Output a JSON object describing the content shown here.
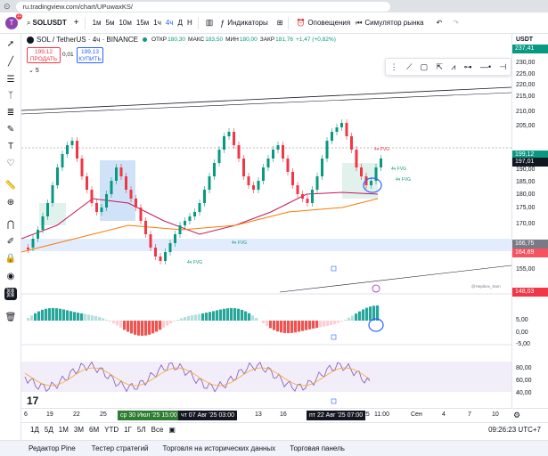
{
  "browser": {
    "url": "ru.tradingview.com/chart/UPuwaxKS/"
  },
  "avatar": {
    "letter": "T",
    "badge": "11"
  },
  "toolbar": {
    "symbol": "SOLUSDT",
    "intervals": [
      "1м",
      "5м",
      "10м",
      "15м",
      "1ч",
      "4ч",
      "Д",
      "Н"
    ],
    "indicators_label": "Индикаторы",
    "alerts_label": "Оповещения",
    "replay_label": "Симулятор рынка"
  },
  "header": {
    "title": "SOL / TetherUS · 4ч · BINANCE",
    "open_label": "ОТКР",
    "open": "180,30",
    "high_label": "МАКС",
    "high": "183,50",
    "low_label": "МИН",
    "low": "180,00",
    "close_label": "ЗАКР",
    "close": "181,76",
    "change": "+1,47 (+0,82%)"
  },
  "trade": {
    "sell_price": "199,12",
    "sell_label": "ПРОДАТЬ",
    "spread": "0,01",
    "buy_price": "199,13",
    "buy_label": "КУПИТЬ"
  },
  "indicator_row": "5",
  "price_axis": {
    "currency": "USDT",
    "ticks": [
      "235,00",
      "230,00",
      "225,00",
      "220,00",
      "215,00",
      "210,00",
      "205,00",
      "195,00",
      "190,00",
      "185,00",
      "180,00",
      "175,00",
      "170,00",
      "160,00",
      "155,00"
    ],
    "labels": [
      {
        "text": "237,41",
        "color": "#089981"
      },
      {
        "text": "199,12",
        "color": "#089981"
      },
      {
        "text": "197,01",
        "color": "#131722"
      },
      {
        "text": "166,75",
        "color": "#787b86"
      },
      {
        "text": "164,69",
        "color": "#f7525f"
      },
      {
        "text": "148,03",
        "color": "#f23645"
      }
    ],
    "osc_ticks": [
      "5,00",
      "0,00",
      "-5,00"
    ],
    "rsi_ticks": [
      "80,00",
      "60,00",
      "40,00"
    ]
  },
  "fvg_label": "4ч FVG",
  "watermark": "@Hepikov_Sam",
  "time_axis": {
    "ticks": [
      "6",
      "19",
      "22",
      "25",
      "13",
      "16",
      "25",
      "11:00",
      "Сен",
      "4",
      "7",
      "10"
    ],
    "highlights": [
      "ср 30 Июл '25  15:00",
      "чт 07 Авг '25  03:00",
      "пт 22 Авг '25  07:00"
    ]
  },
  "ranges": [
    "1Д",
    "5Д",
    "1М",
    "3М",
    "6М",
    "YTD",
    "1Г",
    "5Л",
    "Все"
  ],
  "clock": "09:26:23 UTC+7",
  "bottom_tabs": [
    "Редактор Pine",
    "Тестер стратегий",
    "Торговля на исторических данных",
    "Торговая панель"
  ],
  "colors": {
    "up": "#089981",
    "down": "#f23645",
    "accent": "#2962ff"
  }
}
